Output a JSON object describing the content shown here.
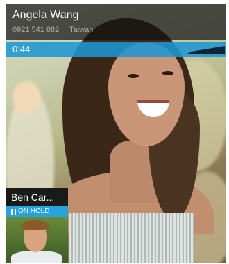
{
  "active_call": {
    "contact_name": "Angela Wang",
    "phone_number": "0921 541 882",
    "location": "Taiwan",
    "duration": "0:44"
  },
  "held_call": {
    "contact_name": "Ben Car...",
    "status_label": "ON HOLD"
  },
  "colors": {
    "accent": "#29a3dd",
    "overlay": "#141414"
  },
  "icons": [
    "signal-strength-icon",
    "pause-icon"
  ]
}
